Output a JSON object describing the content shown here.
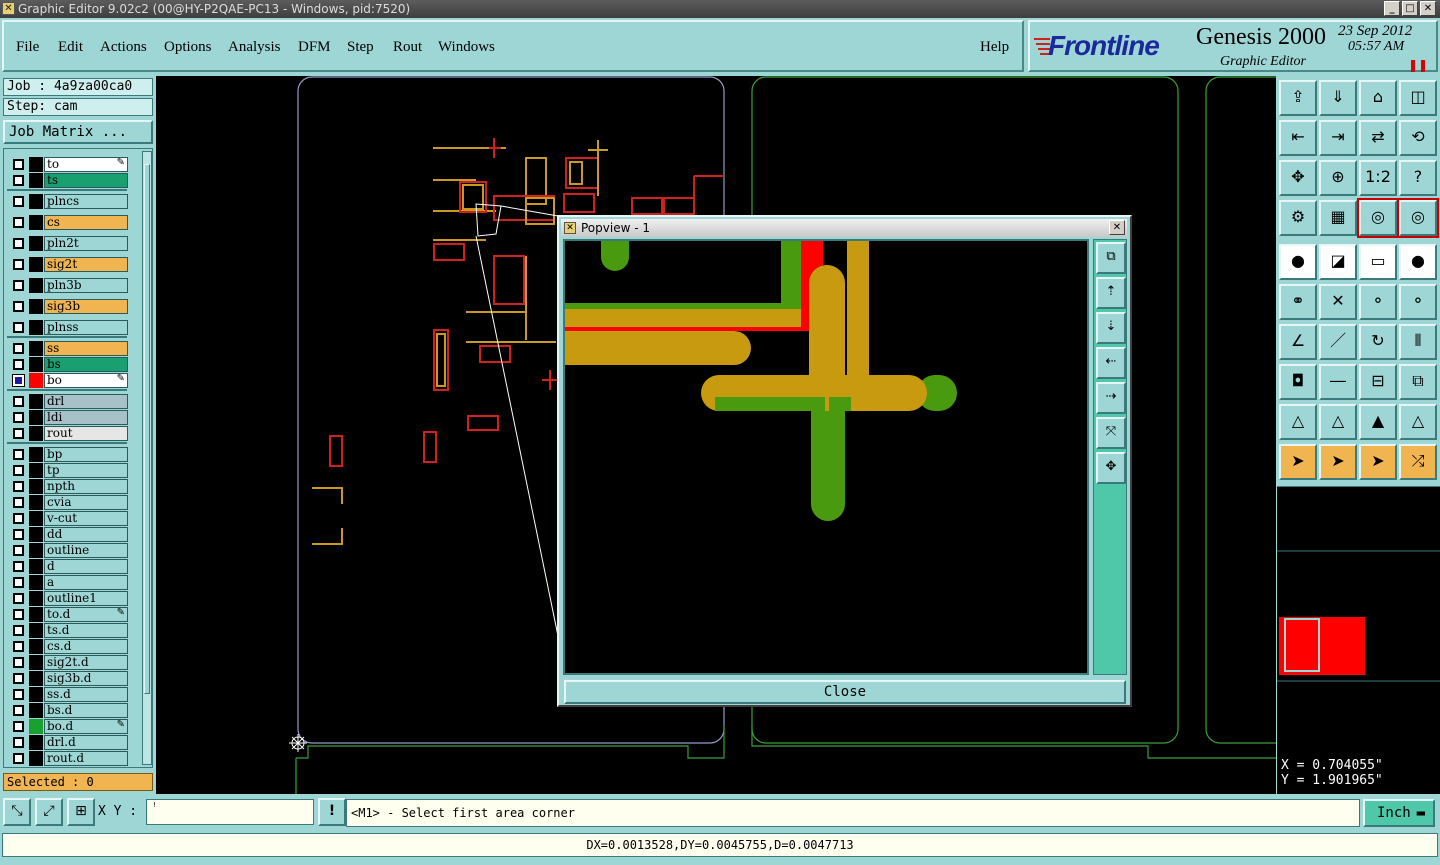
{
  "window": {
    "title": "Graphic Editor 9.02c2 (00@HY-P2QAE-PC13 - Windows, pid:7520)"
  },
  "menu": [
    "File",
    "Edit",
    "Actions",
    "Options",
    "Analysis",
    "DFM",
    "Step",
    "Rout",
    "Windows"
  ],
  "help": "Help",
  "brand": {
    "logo": "Frontline",
    "product": "Genesis 2000",
    "subtitle": "Graphic Editor",
    "date": "23 Sep 2012",
    "time": "05:57 AM"
  },
  "job": {
    "job_line": "Job : 4a9za00ca0",
    "step_line": "Step: cam",
    "job_matrix": "Job Matrix ..."
  },
  "layers": [
    {
      "name": "to",
      "color": "#ffffff",
      "group": 1
    },
    {
      "name": "ts",
      "color": "#1aa070",
      "group": 1
    },
    {
      "name": "plncs",
      "color": "#9ed6d6",
      "group": 2
    },
    {
      "name": "cs",
      "color": "#f0b450",
      "group": 2
    },
    {
      "name": "pln2t",
      "color": "#9ed6d6",
      "group": 2
    },
    {
      "name": "sig2t",
      "color": "#f0b450",
      "group": 2
    },
    {
      "name": "pln3b",
      "color": "#9ed6d6",
      "group": 2
    },
    {
      "name": "sig3b",
      "color": "#f0b450",
      "group": 2
    },
    {
      "name": "plnss",
      "color": "#9ed6d6",
      "group": 2
    },
    {
      "name": "ss",
      "color": "#f0b450",
      "group": 3
    },
    {
      "name": "bs",
      "color": "#1aa070",
      "group": 3
    },
    {
      "name": "bo",
      "color": "#ffffff",
      "group": 3
    },
    {
      "name": "drl",
      "color": "#a8c0c8",
      "group": 4
    },
    {
      "name": "ldi",
      "color": "#a8c0c8",
      "group": 4
    },
    {
      "name": "rout",
      "color": "#e6e6e6",
      "group": 4
    },
    {
      "name": "bp",
      "color": "#9ed6d6",
      "group": 5
    },
    {
      "name": "tp",
      "color": "#9ed6d6",
      "group": 5
    },
    {
      "name": "npth",
      "color": "#9ed6d6",
      "group": 5
    },
    {
      "name": "cvia",
      "color": "#9ed6d6",
      "group": 5
    },
    {
      "name": "v-cut",
      "color": "#9ed6d6",
      "group": 5
    },
    {
      "name": "dd",
      "color": "#9ed6d6",
      "group": 5
    },
    {
      "name": "outline",
      "color": "#9ed6d6",
      "group": 5
    },
    {
      "name": "d",
      "color": "#9ed6d6",
      "group": 5
    },
    {
      "name": "a",
      "color": "#9ed6d6",
      "group": 5
    },
    {
      "name": "outline1",
      "color": "#9ed6d6",
      "group": 5
    },
    {
      "name": "to.d",
      "color": "#9ed6d6",
      "group": 5
    },
    {
      "name": "ts.d",
      "color": "#9ed6d6",
      "group": 5
    },
    {
      "name": "cs.d",
      "color": "#9ed6d6",
      "group": 5
    },
    {
      "name": "sig2t.d",
      "color": "#9ed6d6",
      "group": 5
    },
    {
      "name": "sig3b.d",
      "color": "#9ed6d6",
      "group": 5
    },
    {
      "name": "ss.d",
      "color": "#9ed6d6",
      "group": 5
    },
    {
      "name": "bs.d",
      "color": "#9ed6d6",
      "group": 5
    },
    {
      "name": "bo.d",
      "color": "#9ed6d6",
      "group": 5
    },
    {
      "name": "drl.d",
      "color": "#9ed6d6",
      "group": 5
    },
    {
      "name": "rout.d",
      "color": "#9ed6d6",
      "group": 5
    }
  ],
  "selected": "Selected : 0",
  "popview": {
    "title": "Popview - 1",
    "close": "Close"
  },
  "tool_1to2": "1:2",
  "coords": {
    "x": "X = 0.704055\"",
    "y": "Y = 1.901965\""
  },
  "xy_label": "X Y :",
  "message": "<M1> - Select first area corner",
  "unit": "Inch",
  "status": "DX=0.0013528,DY=0.0045755,D=0.0047713"
}
